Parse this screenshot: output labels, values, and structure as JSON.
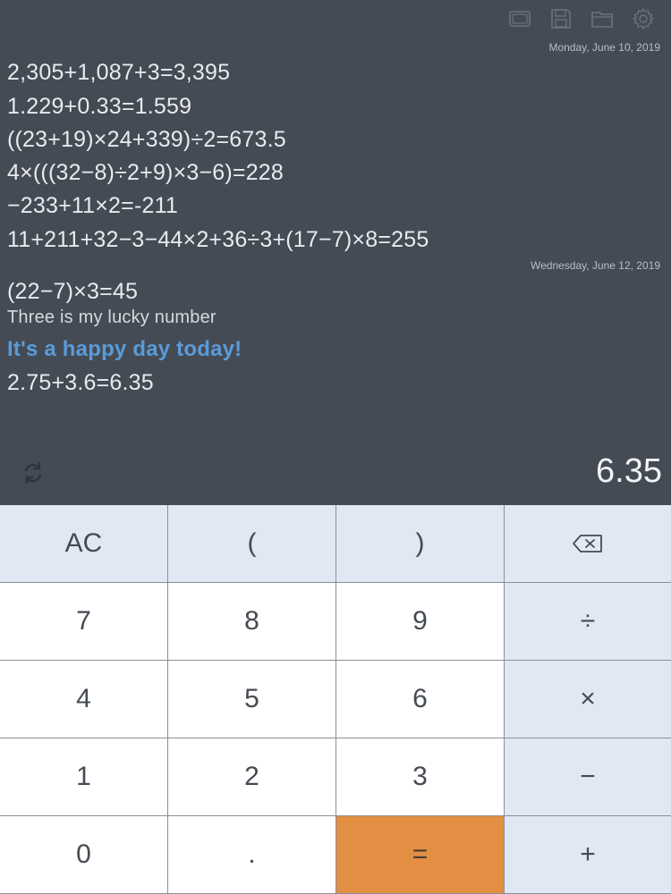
{
  "toolbar": {
    "icons": [
      "screen-icon",
      "save-icon",
      "folder-icon",
      "gear-icon"
    ]
  },
  "history": {
    "groups": [
      {
        "date": "Monday, June 10, 2019",
        "lines": [
          {
            "text": "2,305+1,087+3=3,395",
            "kind": "calc"
          },
          {
            "text": "1.229+0.33=1.559",
            "kind": "calc"
          },
          {
            "text": "((23+19)×24+339)÷2=673.5",
            "kind": "calc"
          },
          {
            "text": "4×(((32−8)÷2+9)×3−6)=228",
            "kind": "calc"
          },
          {
            "text": "−233+11×2=-211",
            "kind": "calc"
          },
          {
            "text": "11+211+32−3−44×2+36÷3+(17−7)×8=255",
            "kind": "calc"
          }
        ]
      },
      {
        "date": "Wednesday, June 12, 2019",
        "lines": [
          {
            "text": "(22−7)×3=45",
            "kind": "calc"
          },
          {
            "text": "Three is my lucky number",
            "kind": "note"
          },
          {
            "text": "It's a happy day today!",
            "kind": "highlight"
          },
          {
            "text": "2.75+3.6=6.35",
            "kind": "calc"
          }
        ]
      }
    ]
  },
  "display": {
    "result": "6.35"
  },
  "keypad": {
    "rows": [
      [
        "AC",
        "(",
        ")",
        "⌫"
      ],
      [
        "7",
        "8",
        "9",
        "÷"
      ],
      [
        "4",
        "5",
        "6",
        "×"
      ],
      [
        "1",
        "2",
        "3",
        "−"
      ],
      [
        "0",
        ".",
        "=",
        "+"
      ]
    ]
  },
  "colors": {
    "background": "#444b55",
    "highlight_text": "#5b9bd8",
    "equals_key": "#e28f43",
    "operator_key": "#e2e8f3"
  }
}
